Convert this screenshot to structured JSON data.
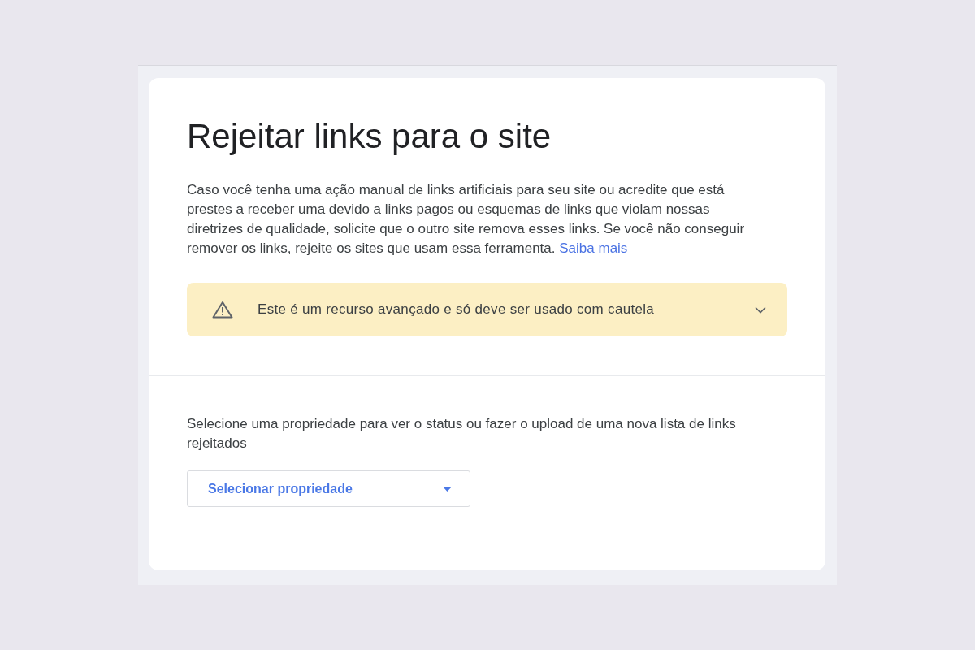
{
  "page": {
    "title": "Rejeitar links para o site"
  },
  "intro": {
    "text": "Caso você tenha uma ação manual de links artificiais para seu site ou acredite que está prestes a receber uma devido a links pagos ou esquemas de links que violam nossas diretrizes de qualidade, solicite que o outro site remova esses links. Se você não conseguir remover os links, rejeite os sites que usam essa ferramenta.",
    "link": "Saiba mais"
  },
  "warning": {
    "text": "Este é um recurso avançado e só deve ser usado com cautela",
    "expanded": false
  },
  "property_section": {
    "prompt": "Selecione uma propriedade para ver o status ou fazer o upload de uma nova lista de links rejeitados",
    "select": {
      "label": "Selecionar propriedade"
    }
  }
}
